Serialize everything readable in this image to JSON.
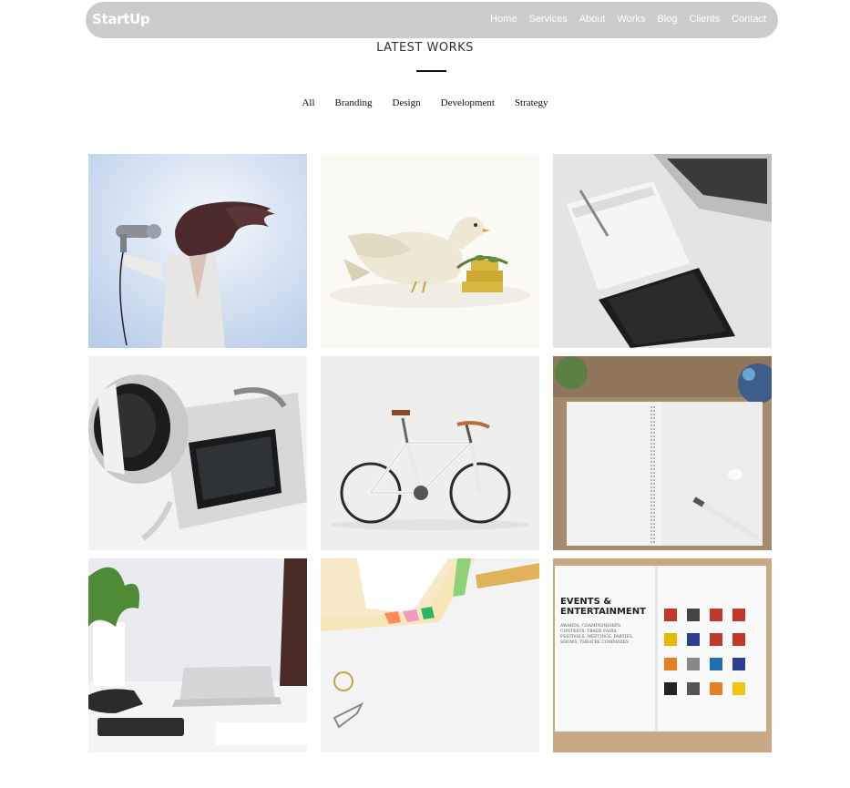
{
  "header": {
    "brand": "StartUp",
    "nav": [
      "Home",
      "Services",
      "About",
      "Works",
      "Blog",
      "Clients",
      "Contact"
    ]
  },
  "section": {
    "title": "LATEST WORKS",
    "filters": [
      "All",
      "Branding",
      "Design",
      "Development",
      "Strategy"
    ]
  },
  "works": [
    {
      "name": "hairdryer-photo"
    },
    {
      "name": "dove-illustration"
    },
    {
      "name": "laptop-notebook-phone-photo"
    },
    {
      "name": "camera-photo"
    },
    {
      "name": "bicycle-photo"
    },
    {
      "name": "spiral-notebook-photo"
    },
    {
      "name": "desk-plant-laptop-photo"
    },
    {
      "name": "paper-ruler-clips-photo"
    },
    {
      "name": "brochure-photo",
      "heading_line1": "EVENTS &",
      "heading_line2": "ENTERTAINMENT",
      "body_line1": "AWARDS, CHAMPIONSHIPS,",
      "body_line2": "CONTESTS, TRADE FAIRS,",
      "body_line3": "FESTIVALS, MEETINGS, PARTIES,",
      "body_line4": "SHOWS, THEATRE COMPANIES"
    }
  ],
  "colors": {
    "navbar": "#cccccc",
    "nav_text": "#ffffff",
    "title": "#333333",
    "rule": "#111111"
  }
}
